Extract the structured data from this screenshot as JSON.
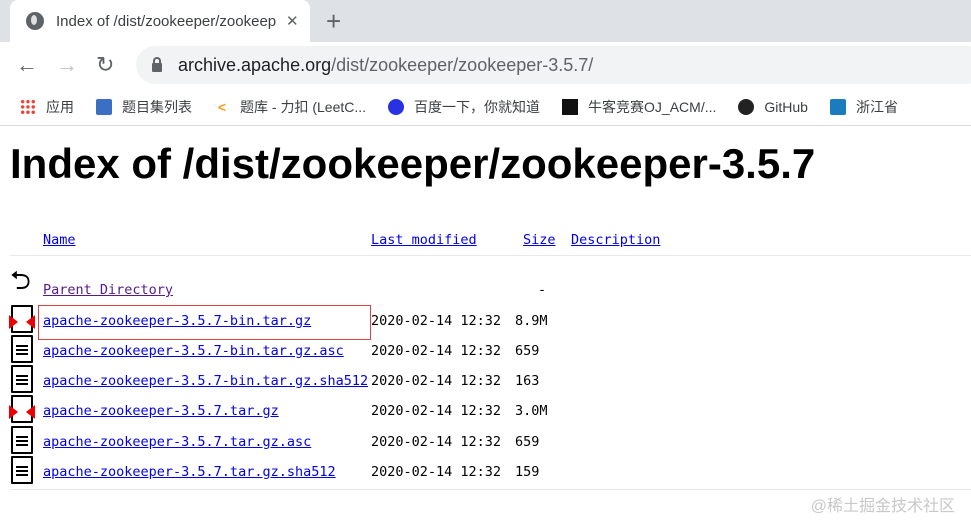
{
  "browser": {
    "tab_title": "Index of /dist/zookeeper/zookeeper-3.5.7",
    "url_host": "archive.apache.org",
    "url_path": "/dist/zookeeper/zookeeper-3.5.7/",
    "bookmarks": [
      {
        "label": "应用",
        "icon": "apps-grid-icon"
      },
      {
        "label": "题目集列表",
        "icon": "pta-icon"
      },
      {
        "label": "题库 - 力扣 (LeetC...",
        "icon": "leetcode-icon"
      },
      {
        "label": "百度一下，你就知道",
        "icon": "baidu-icon"
      },
      {
        "label": "牛客竞赛OJ_ACM/...",
        "icon": "nowcoder-icon"
      },
      {
        "label": "GitHub",
        "icon": "github-icon"
      },
      {
        "label": "浙江省",
        "icon": "bookmark-icon"
      }
    ]
  },
  "page": {
    "title": "Index of /dist/zookeeper/zookeeper-3.5.7",
    "columns": {
      "name": "Name",
      "modified": "Last modified",
      "size": "Size",
      "description": "Description"
    },
    "rows": [
      {
        "name": "Parent Directory",
        "date": "",
        "size": "-",
        "icon": "back-icon"
      },
      {
        "name": "apache-zookeeper-3.5.7-bin.tar.gz",
        "date": "2020-02-14 12:32",
        "size": "8.9M",
        "icon": "compressed-icon"
      },
      {
        "name": "apache-zookeeper-3.5.7-bin.tar.gz.asc",
        "date": "2020-02-14 12:32",
        "size": "659",
        "icon": "text-file-icon"
      },
      {
        "name": "apache-zookeeper-3.5.7-bin.tar.gz.sha512",
        "date": "2020-02-14 12:32",
        "size": "163",
        "icon": "text-file-icon"
      },
      {
        "name": "apache-zookeeper-3.5.7.tar.gz",
        "date": "2020-02-14 12:32",
        "size": "3.0M",
        "icon": "compressed-icon"
      },
      {
        "name": "apache-zookeeper-3.5.7.tar.gz.asc",
        "date": "2020-02-14 12:32",
        "size": "659",
        "icon": "text-file-icon"
      },
      {
        "name": "apache-zookeeper-3.5.7.tar.gz.sha512",
        "date": "2020-02-14 12:32",
        "size": "159",
        "icon": "text-file-icon"
      }
    ]
  },
  "watermark": "@稀土掘金技术社区"
}
